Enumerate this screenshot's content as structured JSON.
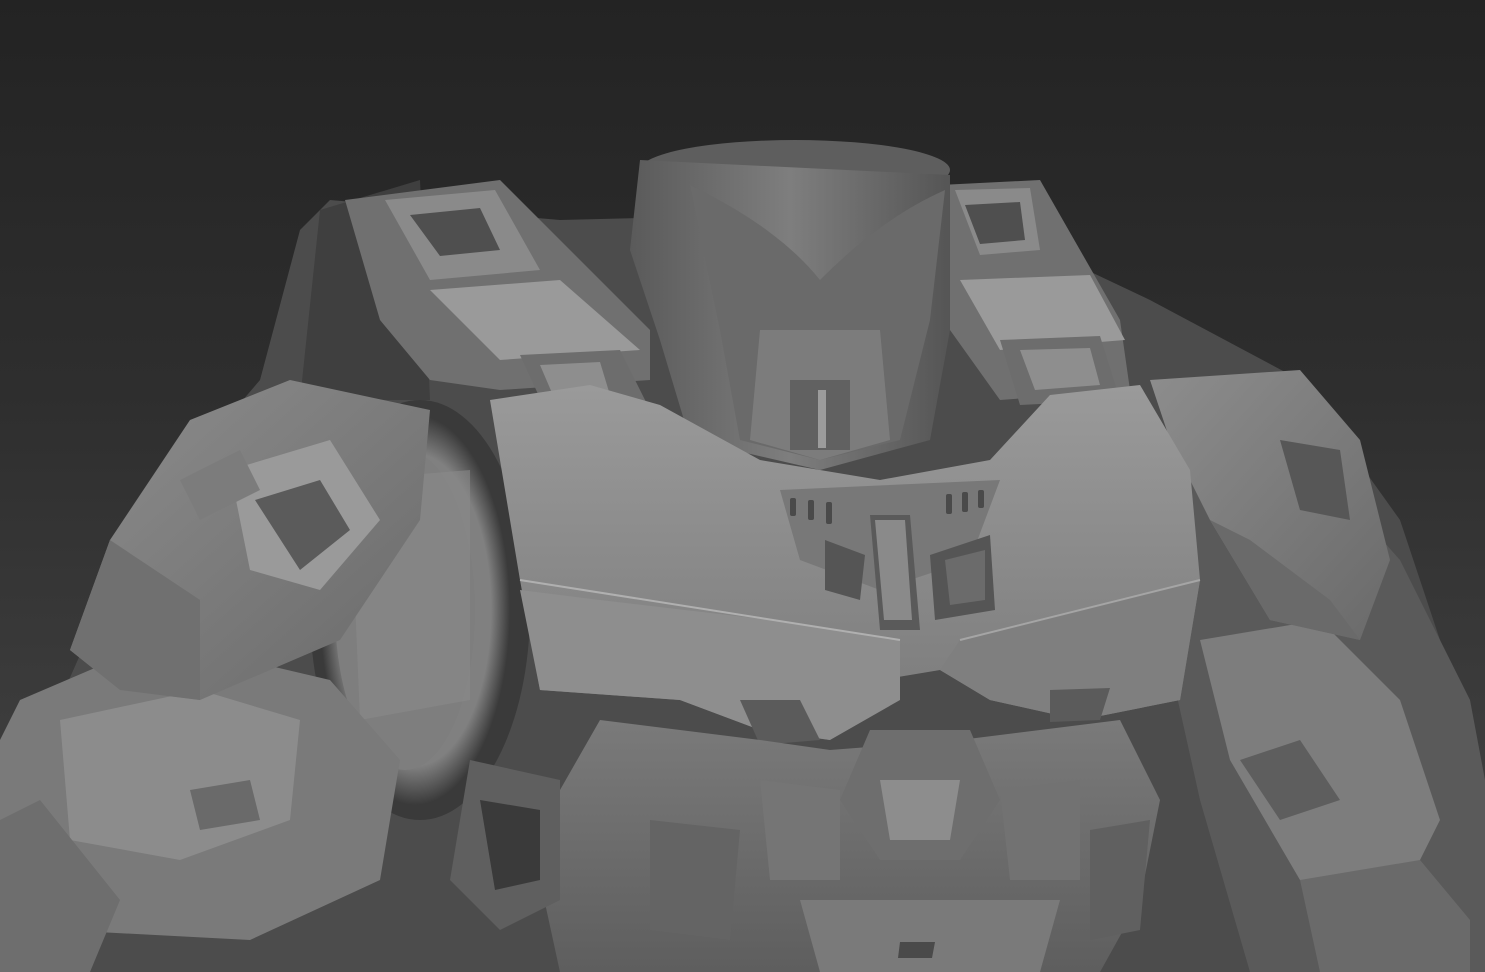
{
  "scene": {
    "subject": "armor-torso-model",
    "render_style": "clay-grey",
    "colors": {
      "background_top": "#232323",
      "background_bottom": "#454545",
      "armor_light": "#8f8f8f",
      "armor_mid": "#6f6f6f",
      "armor_dark": "#4a4a4a",
      "armor_shadow": "#2f2f2f",
      "highlight": "#b5b5b5"
    }
  }
}
